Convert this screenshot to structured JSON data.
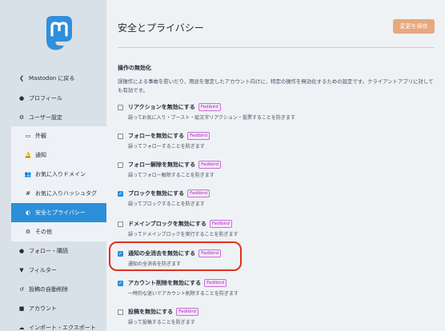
{
  "sidebar": {
    "back": "Mastodon に戻る",
    "profile": "プロフィール",
    "user_settings": "ユーザー設定",
    "sub": [
      {
        "icon": "▭",
        "label": "外観"
      },
      {
        "icon": "🔔",
        "label": "通知"
      },
      {
        "icon": "👥",
        "label": "お気に入りドメイン"
      },
      {
        "icon": "#",
        "label": "お気に入りハッシュタグ"
      },
      {
        "icon": "◐",
        "label": "安全とプライバシー"
      },
      {
        "icon": "⚙",
        "label": "その他"
      }
    ],
    "follow": "フォロー・購読",
    "filter": "フィルター",
    "auto_delete": "投稿の自動削除",
    "account": "アカウント",
    "import_export": "インポート・エクスポート"
  },
  "main": {
    "title": "安全とプライバシー",
    "save": "変更を保存",
    "section_title": "操作の無効化",
    "section_desc": "誤操作による事故を防いだり、用途を限定したアカウント向けに、特定の操作を無効化するための設定です。クライアントアプリに対しても有効です。",
    "badge": "Fedibird",
    "options": [
      {
        "label": "リアクションを無効にする",
        "hint": "誤ってお気に入り・ブースト・絵文字リアクション・投票することを防ぎます",
        "checked": false
      },
      {
        "label": "フォローを無効にする",
        "hint": "誤ってフォローすることを防ぎます",
        "checked": false
      },
      {
        "label": "フォロー解除を無効にする",
        "hint": "誤ってフォロー解除することを防ぎます",
        "checked": false
      },
      {
        "label": "ブロックを無効にする",
        "hint": "誤ってブロックすることを防ぎます",
        "checked": true
      },
      {
        "label": "ドメインブロックを無効にする",
        "hint": "誤ってドメインブロックを実行することを防ぎます",
        "checked": false
      },
      {
        "label": "通知の全消去を無効にする",
        "hint": "通知の全消去を防ぎます",
        "checked": true
      },
      {
        "label": "アカウント削除を無効にする",
        "hint": "一時的な迷いでアカウント削除することを防ぎます",
        "checked": true
      },
      {
        "label": "投稿を無効にする",
        "hint": "誤って投稿することを防ぎます",
        "checked": false
      }
    ]
  }
}
